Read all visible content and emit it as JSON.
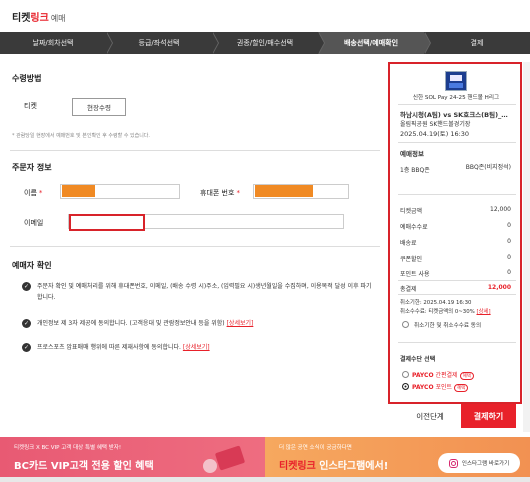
{
  "header": {
    "logo_part1": "티켓",
    "logo_part2": "링크",
    "logo_part3": "예매"
  },
  "steps": [
    {
      "label": "날짜/회차선택"
    },
    {
      "label": "등급/좌석선택"
    },
    {
      "label": "권종/할인/매수선택"
    },
    {
      "label": "배송선택/예매확인"
    },
    {
      "label": "결제"
    }
  ],
  "receive": {
    "title": "수령방법",
    "ticket_label": "티켓",
    "onsite_button": "현장수령",
    "note": "* 관람당일 현장에서 예매번호 및 본인확인 후 수령할 수 있습니다."
  },
  "orderer": {
    "title": "주문자 정보",
    "name_label": "이름",
    "phone_label": "휴대폰 번호",
    "email_label": "이메일",
    "required_mark": "*"
  },
  "confirm": {
    "title": "예매자 확인",
    "items": [
      {
        "text": "주문자 확인 및 예매처리를 위해 휴대폰번호, 이메일, (배송 수령 시)주소, (입력필요 시)생년월일을 수집하며, 이용목적 달성 이후 파기합니다."
      },
      {
        "text": "개인정보 제 3자 제공에 동의합니다. (고객응대 및 관람정보안내 등을 위함)",
        "link": "[상세보기]"
      },
      {
        "text": "프로스포츠 암표매매 행위에 따른 제재사항에 동의합니다.",
        "link": "[상세보기]"
      }
    ]
  },
  "summary": {
    "poster_caption_bold": "SOL Pay",
    "poster_caption": "신한 SOL Pay 24-25 핸드볼 H리그",
    "match": "하남시청(A팀) vs SK호크스(B팀)_…",
    "venue": "올림픽공원 SK핸드볼경기장",
    "date": "2025.04.19(토) 16:30",
    "section_title": "예매정보",
    "seat_left": "1층 BBQ존",
    "seat_right": "BBQ존(비지정석)",
    "rows": [
      {
        "label": "티켓금액",
        "value": "12,000"
      },
      {
        "label": "예매수수료",
        "value": "0"
      },
      {
        "label": "배송료",
        "value": "0"
      },
      {
        "label": "쿠폰할인",
        "value": "0"
      },
      {
        "label": "포인트 사용",
        "value": "0"
      }
    ],
    "total_label": "총결제",
    "total_value": "12,000",
    "cancel_deadline": "취소기한: 2025.04.19 16:30",
    "cancel_fee": "취소수수료: 티켓금액의 0~30%",
    "cancel_fee_link": "[상세]",
    "cancel_agree": "취소기한 및 취소수수료 동의",
    "pay_title": "결제수단 선택",
    "pay_options": [
      {
        "brand": "PAYCO",
        "label": "간편결제",
        "tag": "혜택"
      },
      {
        "brand": "PAYCO",
        "label": "포인트",
        "tag": "혜택"
      }
    ]
  },
  "buttons": {
    "prev": "이전단계",
    "pay": "결제하기"
  },
  "banner": {
    "left_small": "티켓링크 X BC VIP 고객 대상 특별 혜택 받자!",
    "left_big": "BC카드 VIP고객 전용 할인 혜택",
    "right_small": "더 많은 공연 소식이 궁금하다면",
    "right_big_1": "티켓링크",
    "right_big_2": " 인스타그램에서!",
    "insta_button": "인스타그램 바로가기"
  },
  "colors": {
    "accent": "#e8212a",
    "step_bar": "#3a3a3a",
    "highlight_box": "#d8232a",
    "mask_orange": "#f08a24"
  }
}
